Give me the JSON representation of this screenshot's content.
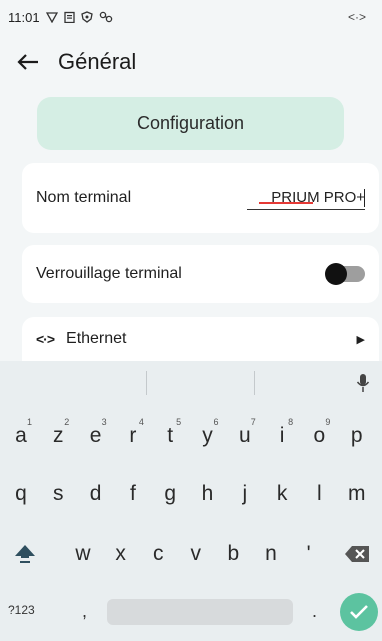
{
  "status_bar": {
    "time": "11:01",
    "icons": [
      "vpn-shield-icon",
      "clipboard-icon",
      "security-icon",
      "link-icon"
    ],
    "right_glyph": "<·>"
  },
  "app_bar": {
    "title": "Général"
  },
  "config_button": {
    "label": "Configuration"
  },
  "settings": {
    "terminal_name": {
      "label": "Nom terminal",
      "value": "PRIUM PRO+"
    },
    "terminal_lock": {
      "label": "Verrouillage terminal",
      "enabled": false
    },
    "ethernet": {
      "icon": "<·>",
      "label": "Ethernet"
    }
  },
  "keyboard": {
    "row1": [
      {
        "k": "a",
        "h": "1"
      },
      {
        "k": "z",
        "h": "2"
      },
      {
        "k": "e",
        "h": "3"
      },
      {
        "k": "r",
        "h": "4"
      },
      {
        "k": "t",
        "h": "5"
      },
      {
        "k": "y",
        "h": "6"
      },
      {
        "k": "u",
        "h": "7"
      },
      {
        "k": "i",
        "h": "8"
      },
      {
        "k": "o",
        "h": "9"
      },
      {
        "k": "p",
        "h": ""
      }
    ],
    "row2": [
      "q",
      "s",
      "d",
      "f",
      "g",
      "h",
      "j",
      "k",
      "l",
      "m"
    ],
    "row3": [
      "w",
      "x",
      "c",
      "v",
      "b",
      "n",
      "'"
    ],
    "symbols_label": "?123",
    "comma": ",",
    "period": ".",
    "accent_color": "#5cc3a0"
  }
}
